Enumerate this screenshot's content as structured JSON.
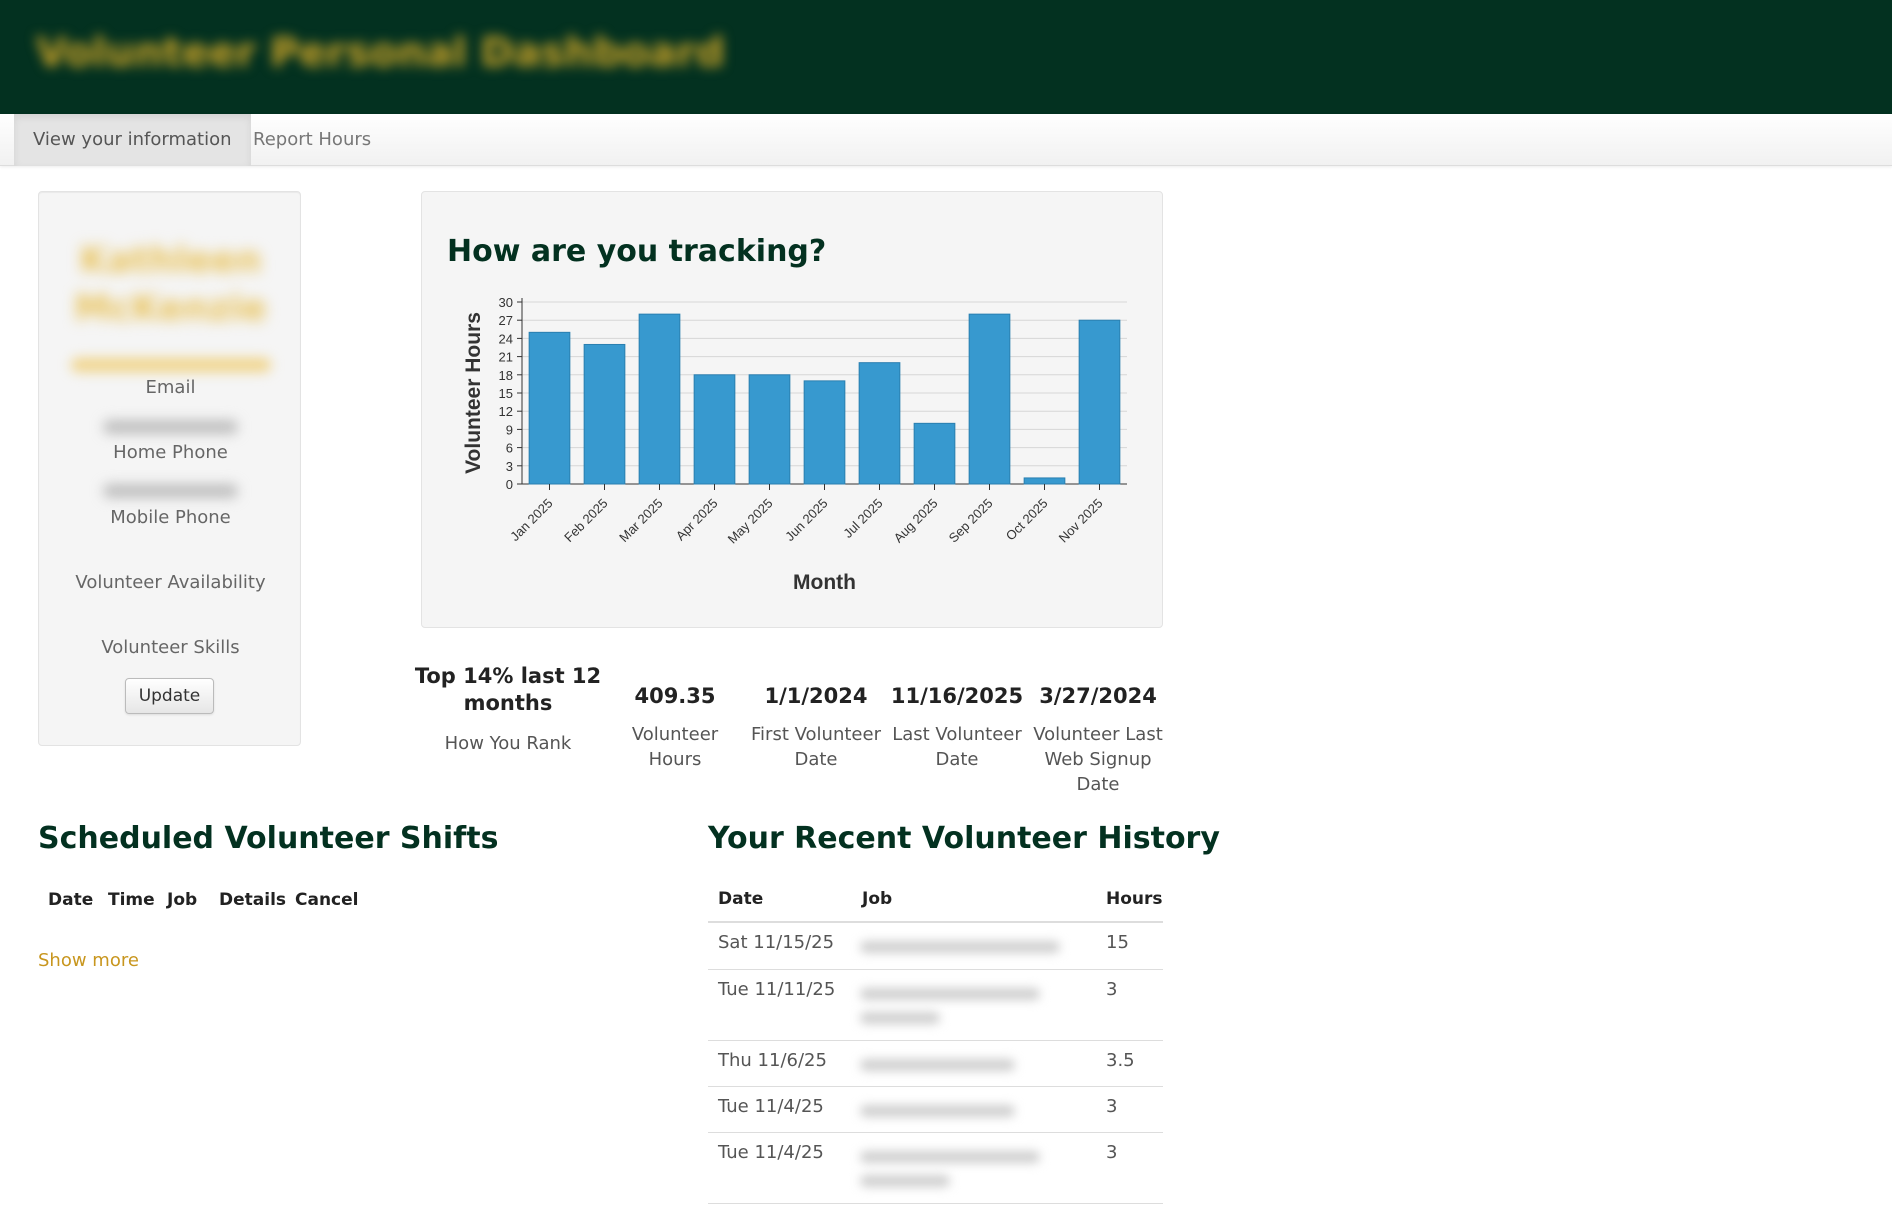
{
  "header": {
    "title": "Volunteer Personal Dashboard"
  },
  "nav": {
    "tabs": [
      {
        "label": "View your information"
      },
      {
        "label": "Report Hours"
      }
    ]
  },
  "profile": {
    "first_name": "Kathleen",
    "last_name": "McKenzie",
    "email_label": "Email",
    "home_phone_label": "Home Phone",
    "mobile_phone_label": "Mobile Phone",
    "availability_label": "Volunteer Availability",
    "skills_label": "Volunteer Skills",
    "update_button": "Update"
  },
  "chart_data": {
    "type": "bar",
    "title": "How are you tracking?",
    "xlabel": "Month",
    "ylabel": "Volunteer Hours",
    "categories": [
      "Jan 2025",
      "Feb 2025",
      "Mar 2025",
      "Apr 2025",
      "May 2025",
      "Jun 2025",
      "Jul 2025",
      "Aug 2025",
      "Sep 2025",
      "Oct 2025",
      "Nov 2025"
    ],
    "values": [
      25,
      23,
      28,
      18,
      18,
      17,
      20,
      10,
      28,
      1,
      27
    ],
    "yticks": [
      0,
      3,
      6,
      9,
      12,
      15,
      18,
      21,
      24,
      27,
      30
    ],
    "ylim": [
      0,
      30
    ],
    "grid": true,
    "bar_color": "#3799cf"
  },
  "stats": [
    {
      "value": "Top 14% last 12 months",
      "label": "How You Rank"
    },
    {
      "value": "409.35",
      "label": "Volunteer Hours"
    },
    {
      "value": "1/1/2024",
      "label": "First Volunteer Date"
    },
    {
      "value": "11/16/2025",
      "label": "Last Volunteer Date"
    },
    {
      "value": "3/27/2024",
      "label": "Volunteer Last Web Signup Date"
    }
  ],
  "shifts": {
    "heading": "Scheduled Volunteer Shifts",
    "columns": [
      "Date",
      "Time",
      "Job",
      "Details",
      "Cancel"
    ],
    "show_more": "Show more"
  },
  "history": {
    "heading": "Your Recent Volunteer History",
    "columns": [
      "Date",
      "Job",
      "Hours"
    ],
    "rows": [
      {
        "date": "Sat 11/15/25",
        "hours": "15"
      },
      {
        "date": "Tue 11/11/25",
        "hours": "3"
      },
      {
        "date": "Thu 11/6/25",
        "hours": "3.5"
      },
      {
        "date": "Tue 11/4/25",
        "hours": "3"
      },
      {
        "date": "Tue 11/4/25",
        "hours": "3"
      }
    ]
  }
}
